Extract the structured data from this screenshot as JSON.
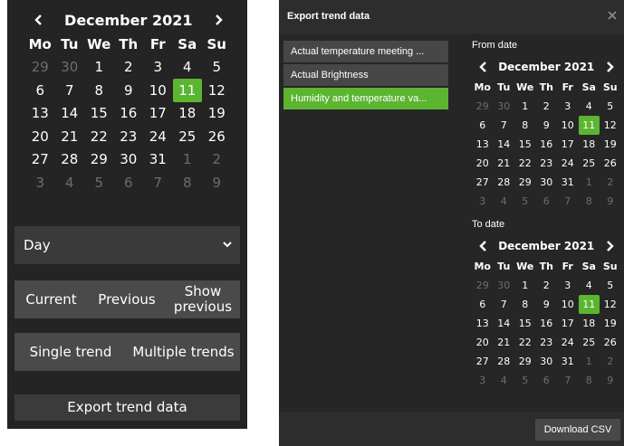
{
  "left_panel": {
    "calendar": {
      "month_label": "December 2021",
      "day_headers": [
        "Mo",
        "Tu",
        "We",
        "Th",
        "Fr",
        "Sa",
        "Su"
      ],
      "weeks": [
        [
          {
            "d": "29",
            "muted": true
          },
          {
            "d": "30",
            "muted": true
          },
          {
            "d": "1"
          },
          {
            "d": "2"
          },
          {
            "d": "3"
          },
          {
            "d": "4"
          },
          {
            "d": "5"
          }
        ],
        [
          {
            "d": "6"
          },
          {
            "d": "7"
          },
          {
            "d": "8"
          },
          {
            "d": "9"
          },
          {
            "d": "10"
          },
          {
            "d": "11",
            "selected": true
          },
          {
            "d": "12"
          }
        ],
        [
          {
            "d": "13"
          },
          {
            "d": "14"
          },
          {
            "d": "15"
          },
          {
            "d": "16"
          },
          {
            "d": "17"
          },
          {
            "d": "18"
          },
          {
            "d": "19"
          }
        ],
        [
          {
            "d": "20"
          },
          {
            "d": "21"
          },
          {
            "d": "22"
          },
          {
            "d": "23"
          },
          {
            "d": "24"
          },
          {
            "d": "25"
          },
          {
            "d": "26"
          }
        ],
        [
          {
            "d": "27"
          },
          {
            "d": "28"
          },
          {
            "d": "29"
          },
          {
            "d": "30"
          },
          {
            "d": "31"
          },
          {
            "d": "1",
            "muted": true
          },
          {
            "d": "2",
            "muted": true
          }
        ],
        [
          {
            "d": "3",
            "muted": true
          },
          {
            "d": "4",
            "muted": true
          },
          {
            "d": "5",
            "muted": true
          },
          {
            "d": "6",
            "muted": true
          },
          {
            "d": "7",
            "muted": true
          },
          {
            "d": "8",
            "muted": true
          },
          {
            "d": "9",
            "muted": true
          }
        ]
      ]
    },
    "period_select": {
      "value": "Day"
    },
    "range_buttons": {
      "current": "Current",
      "previous": "Previous",
      "show_previous": "Show previous"
    },
    "trend_mode": {
      "single": "Single trend",
      "multiple": "Multiple trends"
    },
    "export_button": "Export trend data"
  },
  "dialog": {
    "title": "Export trend data",
    "trends": [
      {
        "label": "Actual temperature meeting ...",
        "active": false
      },
      {
        "label": "Actual Brightness",
        "active": false
      },
      {
        "label": "Humidity and temperature va...",
        "active": true
      }
    ],
    "from_label": "From date",
    "to_label": "To date",
    "download_button": "Download CSV"
  },
  "colors": {
    "accent": "#5cb531",
    "panel_bg": "#242424",
    "button_bg": "#4a4a4a"
  },
  "icons": [
    "chevron-left-icon",
    "chevron-right-icon",
    "chevron-down-icon",
    "close-icon"
  ]
}
